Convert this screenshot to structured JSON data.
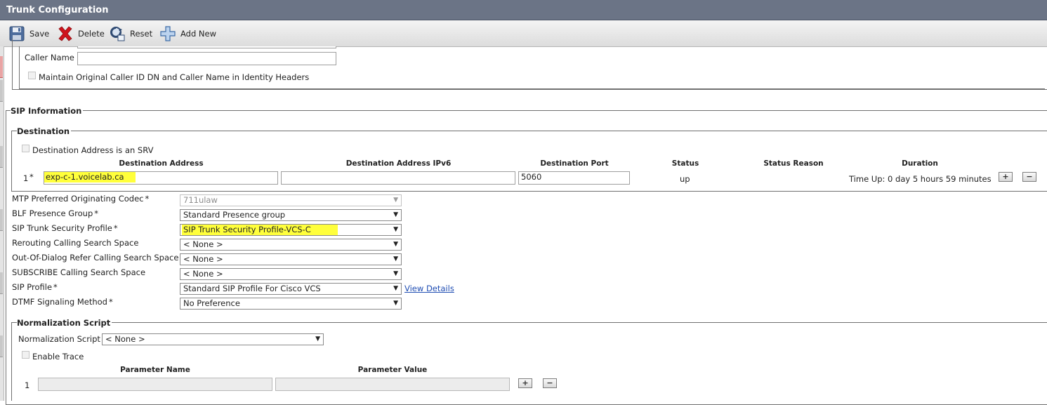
{
  "window": {
    "title": "Trunk Configuration"
  },
  "toolbar": {
    "save_label": "Save",
    "delete_label": "Delete",
    "reset_label": "Reset",
    "add_new_label": "Add New"
  },
  "caller_section": {
    "caller_name_label": "Caller Name",
    "caller_name_value": "",
    "maintain_label": "Maintain Original Caller ID DN and Caller Name in Identity Headers"
  },
  "sip_information": {
    "legend": "SIP Information",
    "destination": {
      "legend": "Destination",
      "srv_label": "Destination Address is an SRV",
      "headers": {
        "address": "Destination Address",
        "ipv6": "Destination Address IPv6",
        "port": "Destination Port",
        "status": "Status",
        "status_reason": "Status Reason",
        "duration": "Duration"
      },
      "row": {
        "index": "1",
        "required": "*",
        "address": "exp-c-1.voicelab.ca",
        "ipv6": "",
        "port": "5060",
        "status": "up",
        "status_reason": "",
        "duration": "Time Up: 0 day 5 hours 59 minutes"
      }
    },
    "fields": [
      {
        "label": "MTP Preferred Originating Codec",
        "required": "*",
        "value": "711ulaw"
      },
      {
        "label": "BLF Presence Group",
        "required": "*",
        "value": "Standard Presence group"
      },
      {
        "label": "SIP Trunk Security Profile",
        "required": "*",
        "value": "SIP Trunk Security Profile-VCS-C"
      },
      {
        "label": "Rerouting Calling Search Space",
        "required": "",
        "value": "< None >"
      },
      {
        "label": "Out-Of-Dialog Refer Calling Search Space",
        "required": "",
        "value": "< None >"
      },
      {
        "label": "SUBSCRIBE Calling Search Space",
        "required": "",
        "value": "< None >"
      },
      {
        "label": "SIP Profile",
        "required": "*",
        "value": "Standard SIP Profile For Cisco VCS"
      },
      {
        "label": "DTMF Signaling Method",
        "required": "*",
        "value": "No Preference"
      }
    ],
    "view_details_link": "View Details",
    "normalization": {
      "legend": "Normalization Script",
      "script_label": "Normalization Script",
      "script_value": "< None >",
      "enable_trace_label": "Enable Trace",
      "param_name_header": "Parameter Name",
      "param_value_header": "Parameter Value",
      "row_index": "1"
    }
  },
  "glyphs": {
    "plus": "+",
    "minus": "−",
    "arrow": "▼"
  },
  "colors": {
    "highlight": "#ffff3b",
    "titlebar": "#6b7486",
    "link": "#1f4db3"
  }
}
